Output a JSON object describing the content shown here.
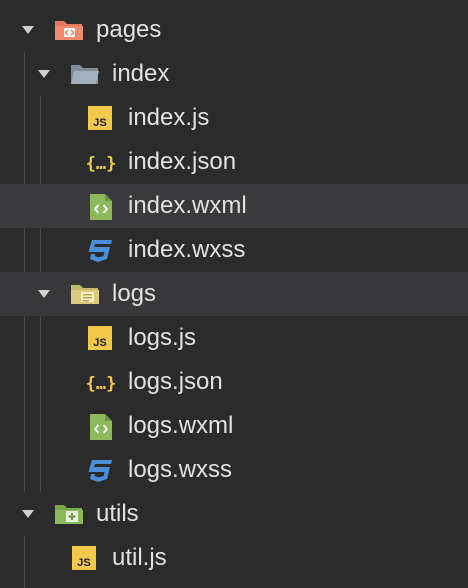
{
  "tree": {
    "items": [
      {
        "label": "pages",
        "icon": "folder-open-icon",
        "color": "#e8795e"
      },
      {
        "label": "index",
        "icon": "folder-open-icon",
        "color": "#8c9aa8"
      },
      {
        "label": "index.js",
        "icon": "js-file-icon",
        "color": "#f2c94c"
      },
      {
        "label": "index.json",
        "icon": "json-file-icon",
        "color": "#f2c94c"
      },
      {
        "label": "index.wxml",
        "icon": "wxml-file-icon",
        "color": "#8bb95c"
      },
      {
        "label": "index.wxss",
        "icon": "css-file-icon",
        "color": "#4a90d9"
      },
      {
        "label": "logs",
        "icon": "folder-open-icon",
        "color": "#d8c77a"
      },
      {
        "label": "logs.js",
        "icon": "js-file-icon",
        "color": "#f2c94c"
      },
      {
        "label": "logs.json",
        "icon": "json-file-icon",
        "color": "#f2c94c"
      },
      {
        "label": "logs.wxml",
        "icon": "wxml-file-icon",
        "color": "#8bb95c"
      },
      {
        "label": "logs.wxss",
        "icon": "css-file-icon",
        "color": "#4a90d9"
      },
      {
        "label": "utils",
        "icon": "folder-open-icon",
        "color": "#8bb95c"
      },
      {
        "label": "util.js",
        "icon": "js-file-icon",
        "color": "#f2c94c"
      }
    ]
  },
  "icon_text": {
    "js": "JS",
    "json": "{…}",
    "wxml": "<>"
  }
}
